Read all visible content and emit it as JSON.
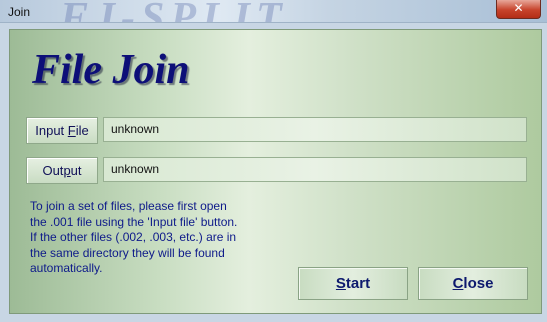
{
  "window": {
    "title": "Join",
    "close_glyph": "✕",
    "banner_text": "FJ-SPLIT"
  },
  "app": {
    "title": "File Join"
  },
  "input_file": {
    "button_pre": "Input ",
    "button_accel": "F",
    "button_post": "ile",
    "value": "unknown"
  },
  "output": {
    "button_pre": "Out",
    "button_accel": "p",
    "button_post": "ut",
    "value": "unknown"
  },
  "help": {
    "lines": [
      "To join a set of files, please first open",
      "the .001 file using the 'Input file' button.",
      "If the other files (.002, .003, etc.) are in",
      "the same directory they will be found",
      "automatically."
    ]
  },
  "actions": {
    "start_accel": "S",
    "start_rest": "tart",
    "close_accel": "C",
    "close_rest": "lose"
  },
  "colors": {
    "title_blue": "#0d0f78",
    "text_blue": "#0e1a8a",
    "panel_green": "#c8ddc1"
  }
}
